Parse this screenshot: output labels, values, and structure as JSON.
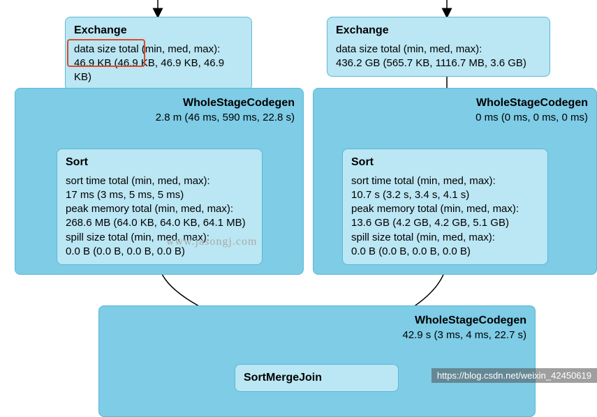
{
  "left": {
    "exchange": {
      "title": "Exchange",
      "line1": "data size total (min, med, max):",
      "line2": "46.9 KB (46.9 KB, 46.9 KB, 46.9 KB)"
    },
    "codegen": {
      "title": "WholeStageCodegen",
      "stats": "2.8 m (46 ms, 590 ms, 22.8 s)"
    },
    "sort": {
      "title": "Sort",
      "l1": "sort time total (min, med, max):",
      "l2": "17 ms (3 ms, 5 ms, 5 ms)",
      "l3": "peak memory total (min, med, max):",
      "l4": "268.6 MB (64.0 KB, 64.0 KB, 64.1 MB)",
      "l5": "spill size total (min, med, max):",
      "l6": "0.0 B (0.0 B, 0.0 B, 0.0 B)"
    }
  },
  "right": {
    "exchange": {
      "title": "Exchange",
      "line1": "data size total (min, med, max):",
      "line2": "436.2 GB (565.7 KB, 1116.7 MB, 3.6 GB)"
    },
    "codegen": {
      "title": "WholeStageCodegen",
      "stats": "0 ms (0 ms, 0 ms, 0 ms)"
    },
    "sort": {
      "title": "Sort",
      "l1": "sort time total (min, med, max):",
      "l2": "10.7 s (3.2 s, 3.4 s, 4.1 s)",
      "l3": "peak memory total (min, med, max):",
      "l4": "13.6 GB (4.2 GB, 4.2 GB, 5.1 GB)",
      "l5": "spill size total (min, med, max):",
      "l6": "0.0 B (0.0 B, 0.0 B, 0.0 B)"
    }
  },
  "bottom": {
    "codegen": {
      "title": "WholeStageCodegen",
      "stats": "42.9 s (3 ms, 4 ms, 22.7 s)"
    },
    "join": {
      "title": "SortMergeJoin"
    }
  },
  "watermark": "www.jasongj.com",
  "attribution": "https://blog.csdn.net/weixin_42450619"
}
